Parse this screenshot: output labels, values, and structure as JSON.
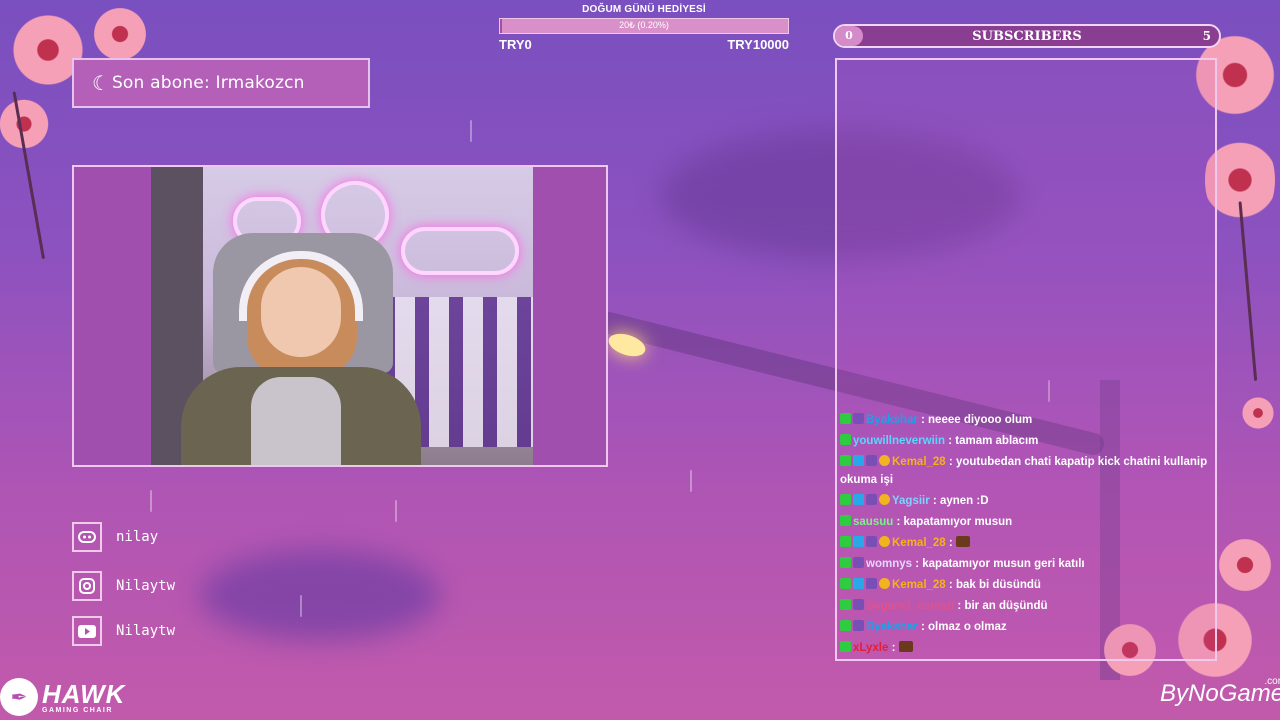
{
  "goal": {
    "title": "DOĞUM GÜNÜ HEDİYESİ",
    "progress_text": "20₺ (0.20%)",
    "progress": 0.002,
    "start": "TRY0",
    "end": "TRY10000"
  },
  "last_sub": {
    "text": "Son abone: Irmakozcn"
  },
  "subscribers": {
    "label": "SUBSCRIBERS",
    "current": "0",
    "target": "5"
  },
  "socials": [
    {
      "icon": "discord-icon",
      "name": "nilay"
    },
    {
      "icon": "instagram-icon",
      "name": "Nilaytw"
    },
    {
      "icon": "youtube-icon",
      "name": "Nilaytw"
    }
  ],
  "chat": [
    {
      "badges": [
        "kick",
        "cup"
      ],
      "user": "Byakshar",
      "color": "#1fa0e8",
      "text": "neeee diyooo olum"
    },
    {
      "badges": [
        "kick"
      ],
      "user": "youwillneverwiin",
      "color": "#58d7ff",
      "text": "tamam ablacım"
    },
    {
      "badges": [
        "kick",
        "gem",
        "cup",
        "coin"
      ],
      "user": "Kemal_28",
      "color": "#f5b21b",
      "text": "youtubedan chati kapatip kick chatini kullanip okuma işi"
    },
    {
      "badges": [
        "kick",
        "gem",
        "cup",
        "coin"
      ],
      "user": "Yagsiir",
      "color": "#7dd2ff",
      "text": "aynen :D"
    },
    {
      "badges": [
        "kick"
      ],
      "user": "sausuu",
      "color": "#7cf08b",
      "text": "kapatamıyor musun"
    },
    {
      "badges": [
        "kick",
        "gem",
        "cup",
        "coin"
      ],
      "user": "Kemal_28",
      "color": "#f5b21b",
      "text": "",
      "emote": true
    },
    {
      "badges": [
        "kick",
        "cup"
      ],
      "user": "womnys",
      "color": "#e6d7ff",
      "text": "kapatamıyor musun geri katılı"
    },
    {
      "badges": [
        "kick",
        "gem",
        "cup",
        "coin"
      ],
      "user": "Kemal_28",
      "color": "#f5b21b",
      "text": "bak bi düsündü"
    },
    {
      "badges": [
        "kick",
        "cup"
      ],
      "user": "Soganci_osman",
      "color": "#e0528c",
      "text": "bir an düşündü"
    },
    {
      "badges": [
        "kick",
        "cup"
      ],
      "user": "Byakshar",
      "color": "#1fa0e8",
      "text": "olmaz o olmaz"
    },
    {
      "badges": [
        "kick"
      ],
      "user": "xLyxle",
      "color": "#e0203a",
      "text": "",
      "emote": true
    }
  ],
  "logos": {
    "hawk_main": "HAWK",
    "hawk_sub": "GAMING CHAIR",
    "bng": "ByNoGame",
    "bng_com": ".com"
  }
}
